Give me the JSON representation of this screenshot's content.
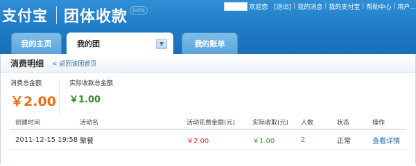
{
  "brand": {
    "logo_text": "支付宝",
    "product_title": "团体收款",
    "beta_badge": "beta"
  },
  "topnav": {
    "welcome": "欢迎您",
    "logout": "[退出]",
    "messages": "我的消息",
    "my_alipay": "我的支付宝",
    "help": "帮助中心",
    "more": "用户..."
  },
  "tabs": [
    {
      "label": "我的主页"
    },
    {
      "label": "我的团"
    },
    {
      "label": "我的账单"
    }
  ],
  "subbar": {
    "title": "消费明细",
    "back_link": "< 返回该团首页"
  },
  "summary": {
    "spent_label": "消费总金额",
    "spent_value": "￥2.00",
    "received_label": "实际收款总金额",
    "received_value": "￥1.00"
  },
  "table": {
    "headers": [
      "创建时间",
      "活动名",
      "活动花费金额(元)",
      "实际收取(元)",
      "人数",
      "状态",
      "操作"
    ],
    "rows": [
      {
        "created": "2011-12-15 19:58",
        "activity": "聚餐",
        "cost": "￥2.00",
        "received": "￥1.00",
        "people": "2",
        "status": "正常",
        "action": "查看详情"
      }
    ]
  },
  "colors": {
    "header_blue": "#1f7ac4",
    "amount_orange": "#e8701a",
    "amount_green": "#2e8f1f",
    "link_blue": "#2a6fb3"
  }
}
